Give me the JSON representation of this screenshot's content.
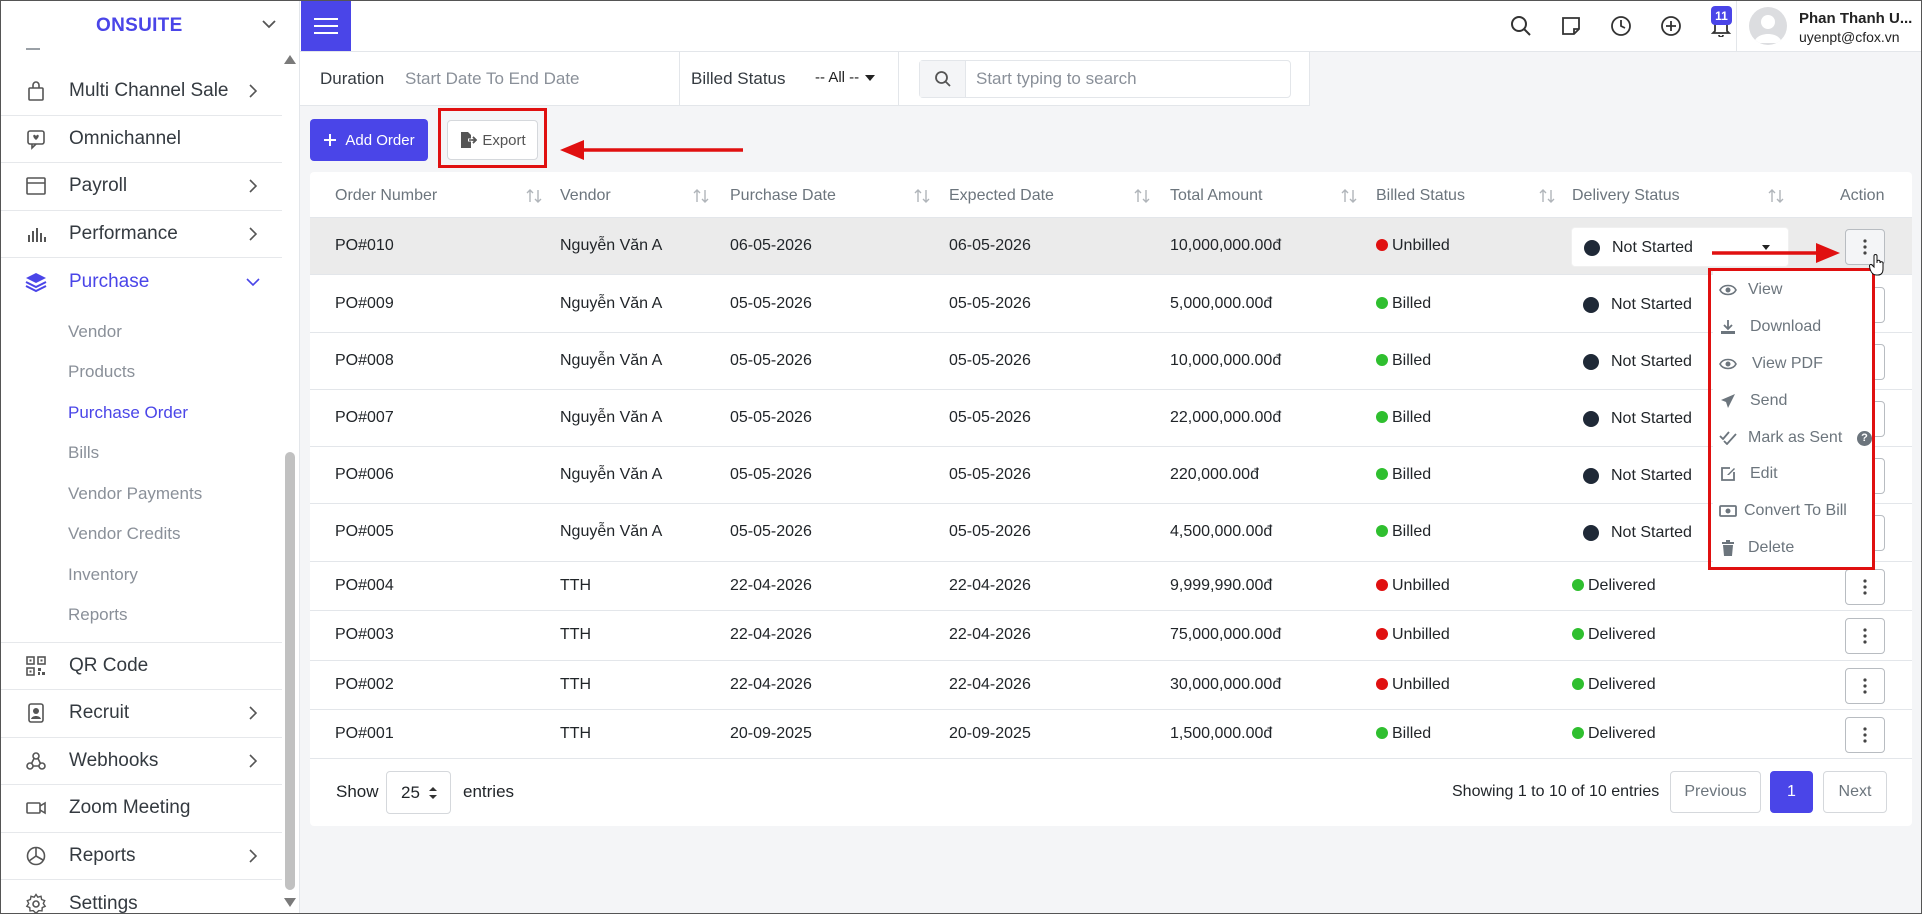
{
  "sidebar": {
    "brand": "ONSUITE",
    "items": [
      {
        "label": "Multi Channel Sale",
        "icon": "shopping-bag-icon"
      },
      {
        "label": "Omnichannel",
        "icon": "chat-heart-icon"
      },
      {
        "label": "Payroll",
        "icon": "window-icon"
      },
      {
        "label": "Performance",
        "icon": "bar-chart-icon"
      },
      {
        "label": "Purchase",
        "icon": "layers-icon"
      },
      {
        "label": "QR Code",
        "icon": "qr-code-icon"
      },
      {
        "label": "Recruit",
        "icon": "id-badge-icon"
      },
      {
        "label": "Webhooks",
        "icon": "webhook-icon"
      },
      {
        "label": "Zoom Meeting",
        "icon": "video-camera-icon"
      },
      {
        "label": "Reports",
        "icon": "pie-chart-icon"
      },
      {
        "label": "Settings",
        "icon": "gear-icon"
      }
    ],
    "purchase_sub": [
      "Vendor",
      "Products",
      "Purchase Order",
      "Bills",
      "Vendor Payments",
      "Vendor Credits",
      "Inventory",
      "Reports"
    ]
  },
  "header": {
    "notification_count": "11",
    "user_name": "Phan Thanh U...",
    "user_email": "uyenpt@cfox.vn"
  },
  "filters": {
    "duration_label": "Duration",
    "duration_placeholder": "Start Date To End Date",
    "billed_label": "Billed Status",
    "billed_value": "-- All --",
    "search_placeholder": "Start typing to search"
  },
  "actions": {
    "add_label": "Add Order",
    "export_label": "Export"
  },
  "table": {
    "headers": [
      "Order Number",
      "Vendor",
      "Purchase Date",
      "Expected Date",
      "Total Amount",
      "Billed Status",
      "Delivery Status",
      "Action"
    ],
    "rows": [
      {
        "order": "PO#010",
        "vendor": "Nguyễn Văn A",
        "purchase": "06-05-2026",
        "expected": "06-05-2026",
        "amount": "10,000,000.00đ",
        "billed": "Unbilled",
        "delivery": "Not Started"
      },
      {
        "order": "PO#009",
        "vendor": "Nguyễn Văn A",
        "purchase": "05-05-2026",
        "expected": "05-05-2026",
        "amount": "5,000,000.00đ",
        "billed": "Billed",
        "delivery": "Not Started"
      },
      {
        "order": "PO#008",
        "vendor": "Nguyễn Văn A",
        "purchase": "05-05-2026",
        "expected": "05-05-2026",
        "amount": "10,000,000.00đ",
        "billed": "Billed",
        "delivery": "Not Started"
      },
      {
        "order": "PO#007",
        "vendor": "Nguyễn Văn A",
        "purchase": "05-05-2026",
        "expected": "05-05-2026",
        "amount": "22,000,000.00đ",
        "billed": "Billed",
        "delivery": "Not Started"
      },
      {
        "order": "PO#006",
        "vendor": "Nguyễn Văn A",
        "purchase": "05-05-2026",
        "expected": "05-05-2026",
        "amount": "220,000.00đ",
        "billed": "Billed",
        "delivery": "Not Started"
      },
      {
        "order": "PO#005",
        "vendor": "Nguyễn Văn A",
        "purchase": "05-05-2026",
        "expected": "05-05-2026",
        "amount": "4,500,000.00đ",
        "billed": "Billed",
        "delivery": "Not Started"
      },
      {
        "order": "PO#004",
        "vendor": "TTH",
        "purchase": "22-04-2026",
        "expected": "22-04-2026",
        "amount": "9,999,990.00đ",
        "billed": "Unbilled",
        "delivery": "Delivered"
      },
      {
        "order": "PO#003",
        "vendor": "TTH",
        "purchase": "22-04-2026",
        "expected": "22-04-2026",
        "amount": "75,000,000.00đ",
        "billed": "Unbilled",
        "delivery": "Delivered"
      },
      {
        "order": "PO#002",
        "vendor": "TTH",
        "purchase": "22-04-2026",
        "expected": "22-04-2026",
        "amount": "30,000,000.00đ",
        "billed": "Unbilled",
        "delivery": "Delivered"
      },
      {
        "order": "PO#001",
        "vendor": "TTH",
        "purchase": "20-09-2025",
        "expected": "20-09-2025",
        "amount": "1,500,000.00đ",
        "billed": "Billed",
        "delivery": "Delivered"
      }
    ]
  },
  "pagination": {
    "show_label": "Show",
    "page_size": "25",
    "entries_label": "entries",
    "info": "Showing 1 to 10 of 10 entries",
    "previous": "Previous",
    "current": "1",
    "next": "Next"
  },
  "action_menu": [
    {
      "label": "View",
      "icon": "eye-icon"
    },
    {
      "label": "Download",
      "icon": "download-icon"
    },
    {
      "label": "View PDF",
      "icon": "eye-icon"
    },
    {
      "label": "Send",
      "icon": "paper-plane-icon"
    },
    {
      "label": "Mark as Sent",
      "icon": "double-check-icon"
    },
    {
      "label": "Edit",
      "icon": "edit-icon"
    },
    {
      "label": "Convert To Bill",
      "icon": "money-icon"
    },
    {
      "label": "Delete",
      "icon": "trash-icon"
    }
  ],
  "colors": {
    "accent": "#4a45e8",
    "billed": "#2fbf2f",
    "unbilled": "#e01010",
    "delivered": "#2fbf2f",
    "not_started": "#1f2937",
    "highlight": "#e01010"
  }
}
